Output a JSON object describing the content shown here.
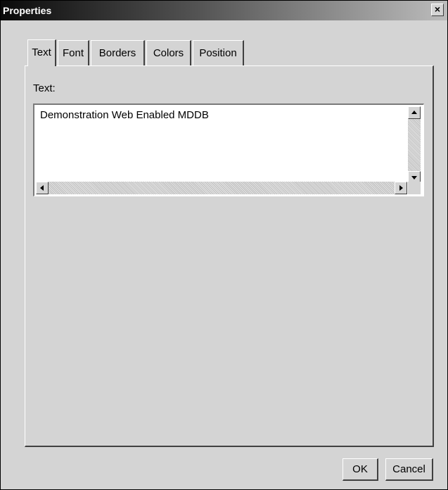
{
  "window": {
    "title": "Properties",
    "close_label": "×"
  },
  "tabs": [
    {
      "label": "Text",
      "active": true
    },
    {
      "label": "Font",
      "active": false
    },
    {
      "label": "Borders",
      "active": false
    },
    {
      "label": "Colors",
      "active": false
    },
    {
      "label": "Position",
      "active": false
    }
  ],
  "text_tab": {
    "label": "Text:",
    "value": "Demonstration Web Enabled MDDB"
  },
  "buttons": {
    "ok": "OK",
    "cancel": "Cancel"
  }
}
